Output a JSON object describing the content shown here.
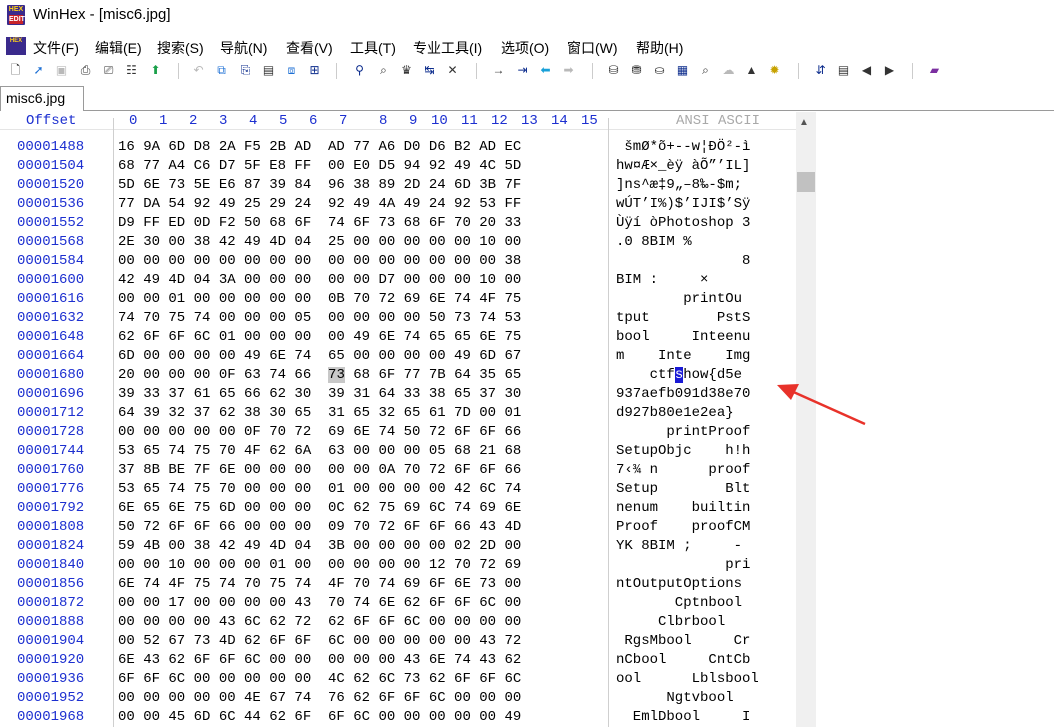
{
  "window": {
    "title": "WinHex - [misc6.jpg]",
    "app_icon_top": "HEX",
    "app_icon_bottom": "EDIT"
  },
  "menu": [
    "文件(F)",
    "编辑(E)",
    "搜索(S)",
    "导航(N)",
    "查看(V)",
    "工具(T)",
    "专业工具(I)",
    "选项(O)",
    "窗口(W)",
    "帮助(H)"
  ],
  "tabs": [
    {
      "label": "misc6.jpg",
      "active": true
    }
  ],
  "header": {
    "offset_label": "Offset",
    "columns": [
      "0",
      "1",
      "2",
      "3",
      "4",
      "5",
      "6",
      "7",
      "8",
      "9",
      "10",
      "11",
      "12",
      "13",
      "14",
      "15"
    ],
    "ansi_label": "ANSI ASCII"
  },
  "rows": [
    {
      "offset": "00001488",
      "hex": "16 9A 6D D8 2A F5 2B AD  AD 77 A6 D0 D6 B2 AD EC",
      "ascii": " šmØ*õ+--w¦ÐÖ²-ì"
    },
    {
      "offset": "00001504",
      "hex": "68 77 A4 C6 D7 5F E8 FF  00 E0 D5 94 92 49 4C 5D",
      "ascii": "hw¤Æ×_èÿ àÕ”’IL]"
    },
    {
      "offset": "00001520",
      "hex": "5D 6E 73 5E E6 87 39 84  96 38 89 2D 24 6D 3B 7F",
      "ascii": "]ns^æ‡9„–8‰-$m;"
    },
    {
      "offset": "00001536",
      "hex": "77 DA 54 92 49 25 29 24  92 49 4A 49 24 92 53 FF",
      "ascii": "wÚT’I%)$’IJI$’Sÿ"
    },
    {
      "offset": "00001552",
      "hex": "D9 FF ED 0D F2 50 68 6F  74 6F 73 68 6F 70 20 33",
      "ascii": "Ùÿí òPhotoshop 3"
    },
    {
      "offset": "00001568",
      "hex": "2E 30 00 38 42 49 4D 04  25 00 00 00 00 00 10 00",
      "ascii": ".0 8BIM %"
    },
    {
      "offset": "00001584",
      "hex": "00 00 00 00 00 00 00 00  00 00 00 00 00 00 00 38",
      "ascii": "               8"
    },
    {
      "offset": "00001600",
      "hex": "42 49 4D 04 3A 00 00 00  00 00 D7 00 00 00 10 00",
      "ascii": "BIM :     ×"
    },
    {
      "offset": "00001616",
      "hex": "00 00 01 00 00 00 00 00  0B 70 72 69 6E 74 4F 75",
      "ascii": "        printOu"
    },
    {
      "offset": "00001632",
      "hex": "74 70 75 74 00 00 00 05  00 00 00 00 50 73 74 53",
      "ascii": "tput        PstS"
    },
    {
      "offset": "00001648",
      "hex": "62 6F 6F 6C 01 00 00 00  00 49 6E 74 65 65 6E 75",
      "ascii": "bool     Inteenu"
    },
    {
      "offset": "00001664",
      "hex": "6D 00 00 00 00 49 6E 74  65 00 00 00 00 49 6D 67",
      "ascii": "m    Inte    Img"
    },
    {
      "offset": "00001680",
      "hex": "20 00 00 00 0F 63 74 66  73 68 6F 77 7B 64 35 65",
      "ascii": "    ctfshow{d5e"
    },
    {
      "offset": "00001696",
      "hex": "39 33 37 61 65 66 62 30  39 31 64 33 38 65 37 30",
      "ascii": "937aefb091d38e70"
    },
    {
      "offset": "00001712",
      "hex": "64 39 32 37 62 38 30 65  31 65 32 65 61 7D 00 01",
      "ascii": "d927b80e1e2ea}"
    },
    {
      "offset": "00001728",
      "hex": "00 00 00 00 00 0F 70 72  69 6E 74 50 72 6F 6F 66",
      "ascii": "      printProof"
    },
    {
      "offset": "00001744",
      "hex": "53 65 74 75 70 4F 62 6A  63 00 00 00 05 68 21 68",
      "ascii": "SetupObjc    h!h"
    },
    {
      "offset": "00001760",
      "hex": "37 8B BE 7F 6E 00 00 00  00 00 0A 70 72 6F 6F 66",
      "ascii": "7‹¾ n      proof"
    },
    {
      "offset": "00001776",
      "hex": "53 65 74 75 70 00 00 00  01 00 00 00 00 42 6C 74",
      "ascii": "Setup        Blt"
    },
    {
      "offset": "00001792",
      "hex": "6E 65 6E 75 6D 00 00 00  0C 62 75 69 6C 74 69 6E",
      "ascii": "nenum    builtin"
    },
    {
      "offset": "00001808",
      "hex": "50 72 6F 6F 66 00 00 00  09 70 72 6F 6F 66 43 4D",
      "ascii": "Proof    proofCM"
    },
    {
      "offset": "00001824",
      "hex": "59 4B 00 38 42 49 4D 04  3B 00 00 00 00 02 2D 00",
      "ascii": "YK 8BIM ;     -"
    },
    {
      "offset": "00001840",
      "hex": "00 00 10 00 00 00 01 00  00 00 00 00 12 70 72 69",
      "ascii": "             pri"
    },
    {
      "offset": "00001856",
      "hex": "6E 74 4F 75 74 70 75 74  4F 70 74 69 6F 6E 73 00",
      "ascii": "ntOutputOptions"
    },
    {
      "offset": "00001872",
      "hex": "00 00 17 00 00 00 00 43  70 74 6E 62 6F 6F 6C 00",
      "ascii": "       Cptnbool"
    },
    {
      "offset": "00001888",
      "hex": "00 00 00 00 43 6C 62 72  62 6F 6F 6C 00 00 00 00",
      "ascii": "     Clbrbool"
    },
    {
      "offset": "00001904",
      "hex": "00 52 67 73 4D 62 6F 6F  6C 00 00 00 00 00 43 72",
      "ascii": " RgsMbool     Cr"
    },
    {
      "offset": "00001920",
      "hex": "6E 43 62 6F 6F 6C 00 00  00 00 00 43 6E 74 43 62",
      "ascii": "nCbool     CntCb"
    },
    {
      "offset": "00001936",
      "hex": "6F 6F 6C 00 00 00 00 00  4C 62 6C 73 62 6F 6F 6C",
      "ascii": "ool      Lblsbool"
    },
    {
      "offset": "00001952",
      "hex": "00 00 00 00 00 4E 67 74  76 62 6F 6F 6C 00 00 00",
      "ascii": "      Ngtvbool"
    },
    {
      "offset": "00001968",
      "hex": "00 00 45 6D 6C 44 62 6F  6F 6C 00 00 00 00 00 49",
      "ascii": "  EmlDbool     I"
    }
  ],
  "highlight": {
    "row": 12,
    "char": "s",
    "byte": "73"
  },
  "colors": {
    "offset": "#1c2fd0",
    "ansi_header": "#a9a9a9",
    "selection": "#1a1ad6",
    "annotation_arrow": "#e8322a"
  }
}
